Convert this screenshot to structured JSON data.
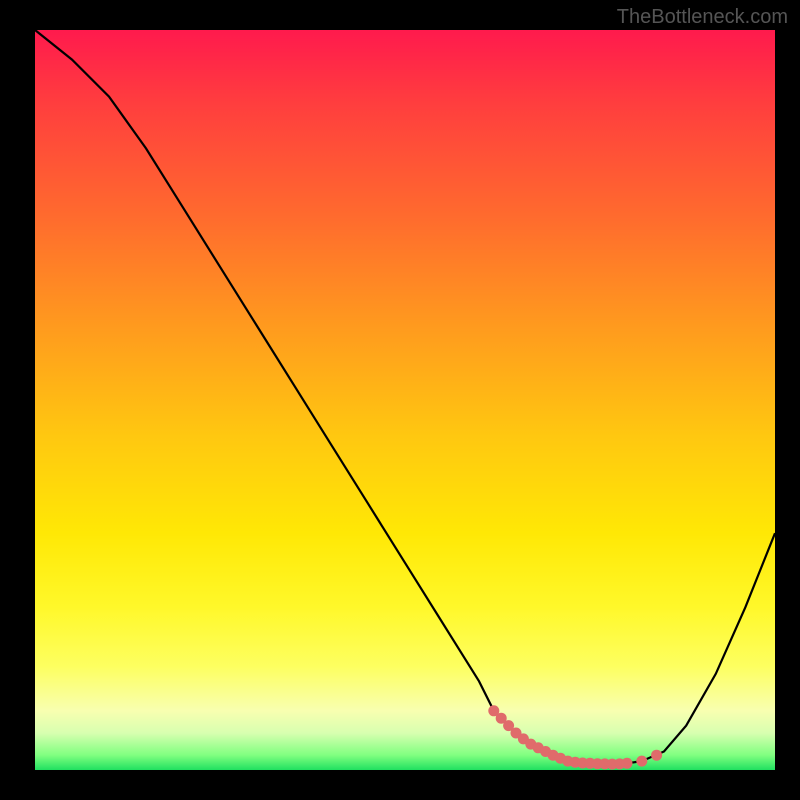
{
  "watermark": "TheBottleneck.com",
  "chart_data": {
    "type": "line",
    "title": "",
    "xlabel": "",
    "ylabel": "",
    "xlim": [
      0,
      100
    ],
    "ylim": [
      0,
      100
    ],
    "series": [
      {
        "name": "curve",
        "x": [
          0,
          5,
          10,
          15,
          20,
          25,
          30,
          35,
          40,
          45,
          50,
          55,
          60,
          62,
          65,
          68,
          70,
          72,
          75,
          78,
          80,
          82,
          85,
          88,
          92,
          96,
          100
        ],
        "y": [
          100,
          96,
          91,
          84,
          76,
          68,
          60,
          52,
          44,
          36,
          28,
          20,
          12,
          8,
          5,
          3,
          2,
          1.2,
          0.9,
          0.8,
          0.9,
          1.2,
          2.5,
          6,
          13,
          22,
          32
        ]
      }
    ],
    "markers": {
      "name": "highlight-dots",
      "color": "#e06b6b",
      "x": [
        62,
        63,
        64,
        65,
        66,
        67,
        68,
        69,
        70,
        71,
        72,
        73,
        74,
        75,
        76,
        77,
        78,
        79,
        80,
        82,
        84
      ],
      "y": [
        8,
        7,
        6,
        5,
        4.2,
        3.5,
        3,
        2.5,
        2,
        1.6,
        1.2,
        1.05,
        0.95,
        0.9,
        0.85,
        0.82,
        0.8,
        0.82,
        0.9,
        1.2,
        2.0
      ]
    },
    "grid": false,
    "legend": false
  }
}
